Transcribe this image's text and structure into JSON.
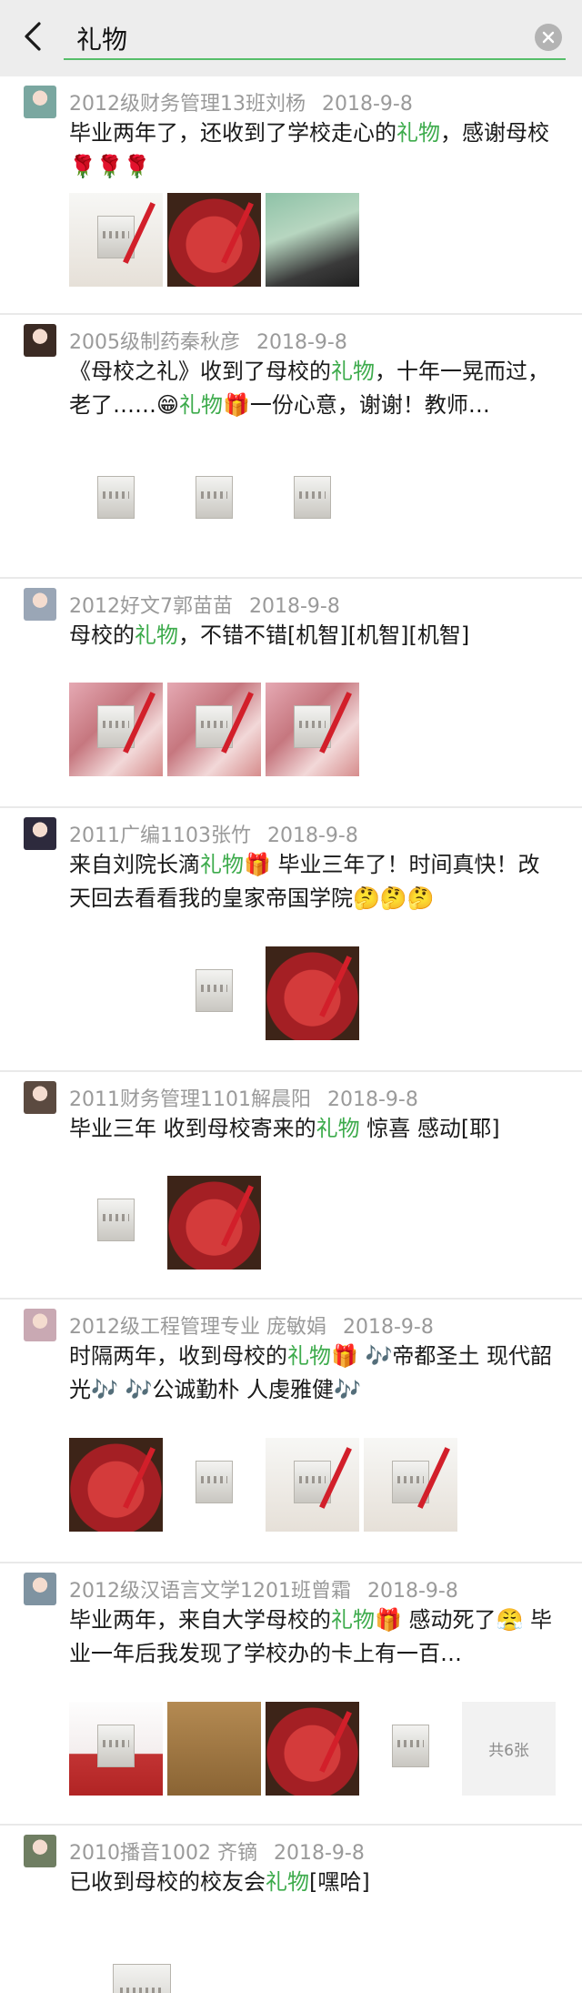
{
  "search": {
    "query": "礼物"
  },
  "posts": [
    {
      "author": "2012级财务管理13班刘杨",
      "date": "2018-9-8",
      "text": [
        {
          "t": "毕业两年了，还收到了学校走心的"
        },
        {
          "t": "礼物",
          "hl": true
        },
        {
          "t": "，感谢母校🌹🌹🌹"
        }
      ],
      "photos": [
        "white",
        "red",
        "girl"
      ]
    },
    {
      "author": "2005级制药秦秋彦",
      "date": "2018-9-8",
      "text": [
        {
          "t": "《母校之礼》收到了母校的"
        },
        {
          "t": "礼物",
          "hl": true
        },
        {
          "t": "，十年一晃而过，老了……😁"
        },
        {
          "t": "礼物",
          "hl": true
        },
        {
          "t": "🎁一份心意，谢谢！教师…"
        }
      ],
      "photos": [
        "gold",
        "gold",
        "gold",
        "dark"
      ]
    },
    {
      "author": "2012好文7郭苗苗",
      "date": "2018-9-8",
      "text": [
        {
          "t": "母校的"
        },
        {
          "t": "礼物",
          "hl": true
        },
        {
          "t": "，不错不错[机智][机智][机智]"
        }
      ],
      "photos": [
        "hand",
        "hand",
        "hand"
      ]
    },
    {
      "author": "2011广编1103张竹",
      "date": "2018-9-8",
      "text": [
        {
          "t": "来自刘院长滴"
        },
        {
          "t": "礼物",
          "hl": true
        },
        {
          "t": "🎁 毕业三年了！时间真快！改天回去看看我的皇家帝国学院🤔🤔🤔"
        }
      ],
      "photos": [
        "dark",
        "gold",
        "red"
      ]
    },
    {
      "author": "2011财务管理1101解晨阳",
      "date": "2018-9-8",
      "text": [
        {
          "t": "毕业三年 收到母校寄来的"
        },
        {
          "t": "礼物",
          "hl": true
        },
        {
          "t": " 惊喜 感动[耶]"
        }
      ],
      "photos": [
        "gold",
        "red"
      ]
    },
    {
      "author": "2012级工程管理专业 庞敏娟",
      "date": "2018-9-8",
      "text": [
        {
          "t": "时隔两年，收到母校的"
        },
        {
          "t": "礼物",
          "hl": true
        },
        {
          "t": "🎁 🎶帝都圣土 现代韶光🎶 🎶公诚勤朴 人虔雅健🎶"
        }
      ],
      "photos": [
        "red",
        "gold",
        "white",
        "white"
      ]
    },
    {
      "author": "2012级汉语言文学1201班曾霜",
      "date": "2018-9-8",
      "text": [
        {
          "t": "毕业两年，来自大学母校的"
        },
        {
          "t": "礼物",
          "hl": true
        },
        {
          "t": "🎁 感动死了😤 毕业一年后我发现了学校办的卡上有一百…"
        }
      ],
      "photos": [
        "card",
        "carton",
        "red",
        "gold"
      ],
      "more_label": "共6张"
    },
    {
      "author": "2010播音1002 齐镝",
      "date": "2018-9-8",
      "text": [
        {
          "t": "已收到母校的校友会"
        },
        {
          "t": "礼物",
          "hl": true
        },
        {
          "t": "[嘿哈]"
        }
      ],
      "photos": [
        "gold"
      ]
    }
  ]
}
